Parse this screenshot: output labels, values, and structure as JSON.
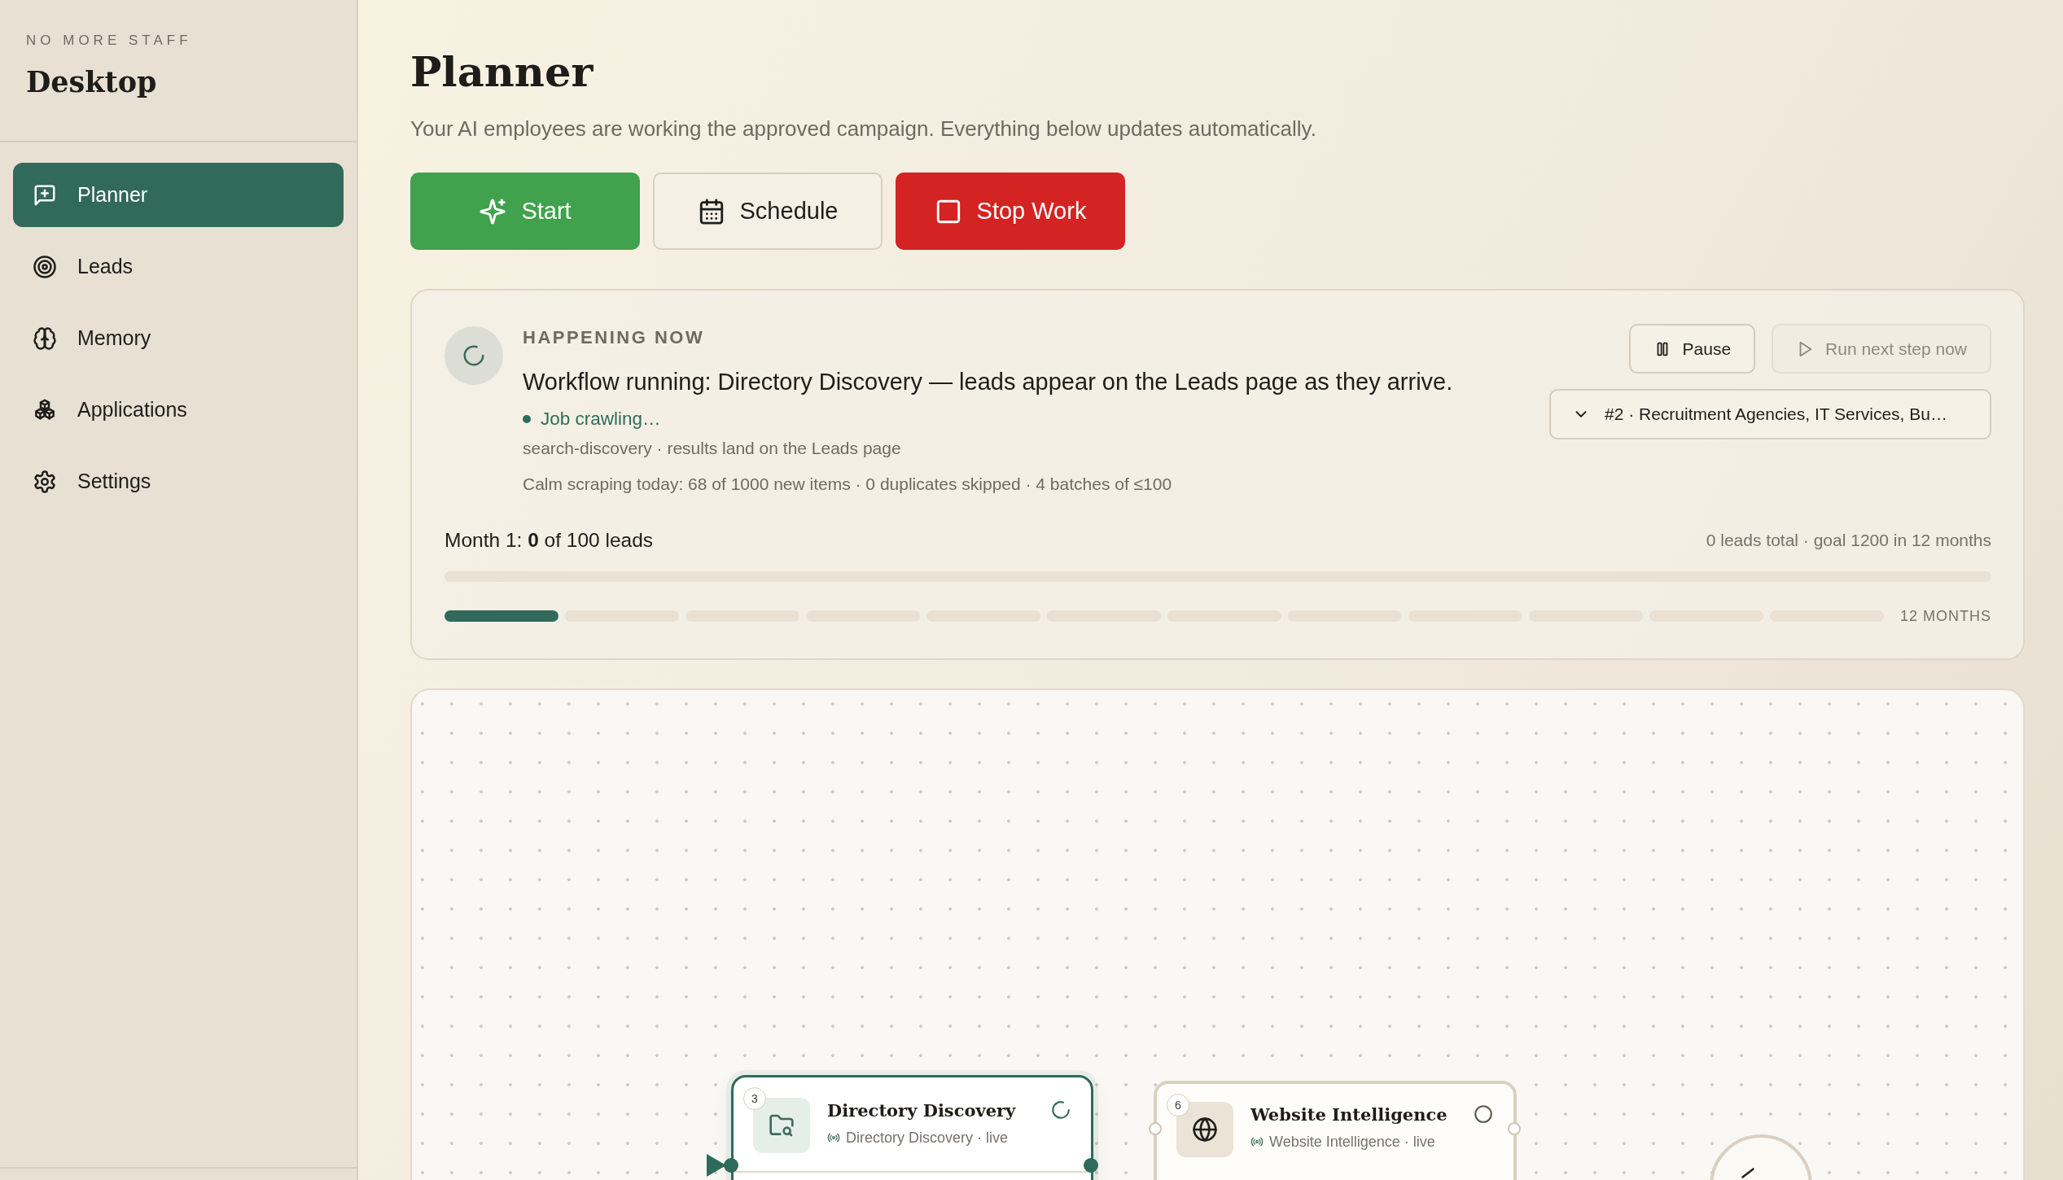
{
  "sidebar": {
    "brand": "NO MORE STAFF",
    "title": "Desktop",
    "items": [
      {
        "label": "Planner",
        "selected": true
      },
      {
        "label": "Leads",
        "selected": false
      },
      {
        "label": "Memory",
        "selected": false
      },
      {
        "label": "Applications",
        "selected": false
      },
      {
        "label": "Settings",
        "selected": false
      }
    ]
  },
  "header": {
    "title": "Planner",
    "subtitle": "Your AI employees are working the approved campaign. Everything below updates automatically."
  },
  "actions": [
    {
      "label": "Start",
      "kind": "primary"
    },
    {
      "label": "Schedule",
      "kind": "secondary"
    },
    {
      "label": "Stop Work",
      "kind": "danger"
    }
  ],
  "status_card": {
    "heading": "HAPPENING NOW",
    "message": "Workflow running: Directory Discovery — leads appear on the Leads page as they arrive.",
    "job_status": "Job crawling…",
    "source": "search-discovery · results land on the Leads page",
    "stats": "Calm scraping today: 68 of 1000 new items · 0 duplicates skipped · 4 batches of ≤100",
    "controls": [
      {
        "label": "Pause",
        "disabled": false
      },
      {
        "label": "Run next step now",
        "disabled": true
      }
    ],
    "campaign_select": {
      "value": "#2 · Recruitment Agencies, IT Services, Bu…"
    },
    "month_progress": {
      "label": "Month 1: **0** of 100 leads",
      "level": 0
    },
    "totals": "0 leads total · goal 1200 in 12 months",
    "months": [
      {
        "filled": true
      },
      {
        "filled": false
      },
      {
        "filled": false
      },
      {
        "filled": false
      },
      {
        "filled": false
      },
      {
        "filled": false
      },
      {
        "filled": false
      },
      {
        "filled": false
      },
      {
        "filled": false
      },
      {
        "filled": false
      },
      {
        "filled": false
      },
      {
        "filled": false
      }
    ],
    "months_label": "12 MONTHS"
  },
  "canvas": {
    "nodes": [
      {
        "kind": "step",
        "number": "3",
        "title": "Directory Discovery",
        "subtitle": "Directory Discovery · live",
        "running": true,
        "selected": true
      },
      {
        "kind": "step",
        "number": "6",
        "title": "Website Intelligence",
        "subtitle": "Website Intelligence · live",
        "running": false,
        "selected": false
      },
      {
        "kind": "end"
      }
    ]
  }
}
